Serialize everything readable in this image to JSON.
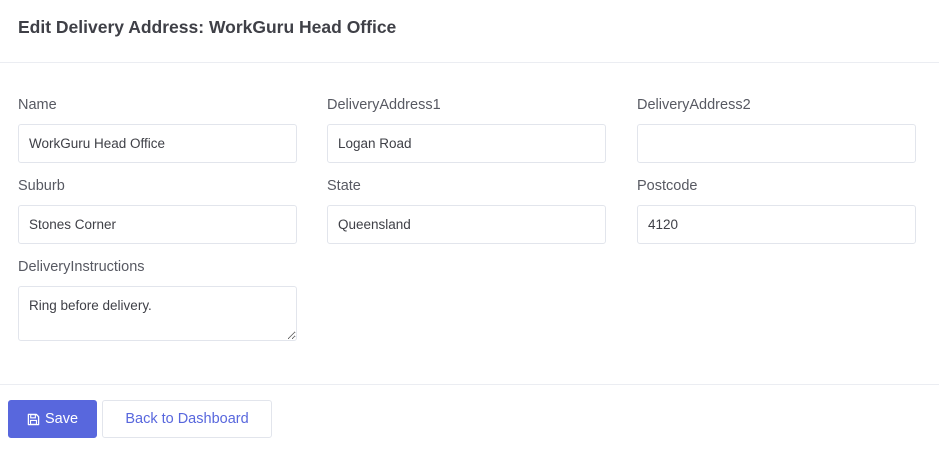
{
  "page": {
    "title": "Edit Delivery Address: WorkGuru Head Office"
  },
  "form": {
    "name": {
      "label": "Name",
      "value": "WorkGuru Head Office"
    },
    "address1": {
      "label": "DeliveryAddress1",
      "value": "Logan Road"
    },
    "address2": {
      "label": "DeliveryAddress2",
      "value": ""
    },
    "suburb": {
      "label": "Suburb",
      "value": "Stones Corner"
    },
    "state": {
      "label": "State",
      "value": "Queensland"
    },
    "postcode": {
      "label": "Postcode",
      "value": "4120"
    },
    "instructions": {
      "label": "DeliveryInstructions",
      "value": "Ring before delivery."
    }
  },
  "actions": {
    "save_label": "Save",
    "back_label": "Back to Dashboard",
    "save_icon": "floppy-disk-icon"
  },
  "colors": {
    "accent": "#5867dd",
    "border": "#e2e5ec"
  }
}
